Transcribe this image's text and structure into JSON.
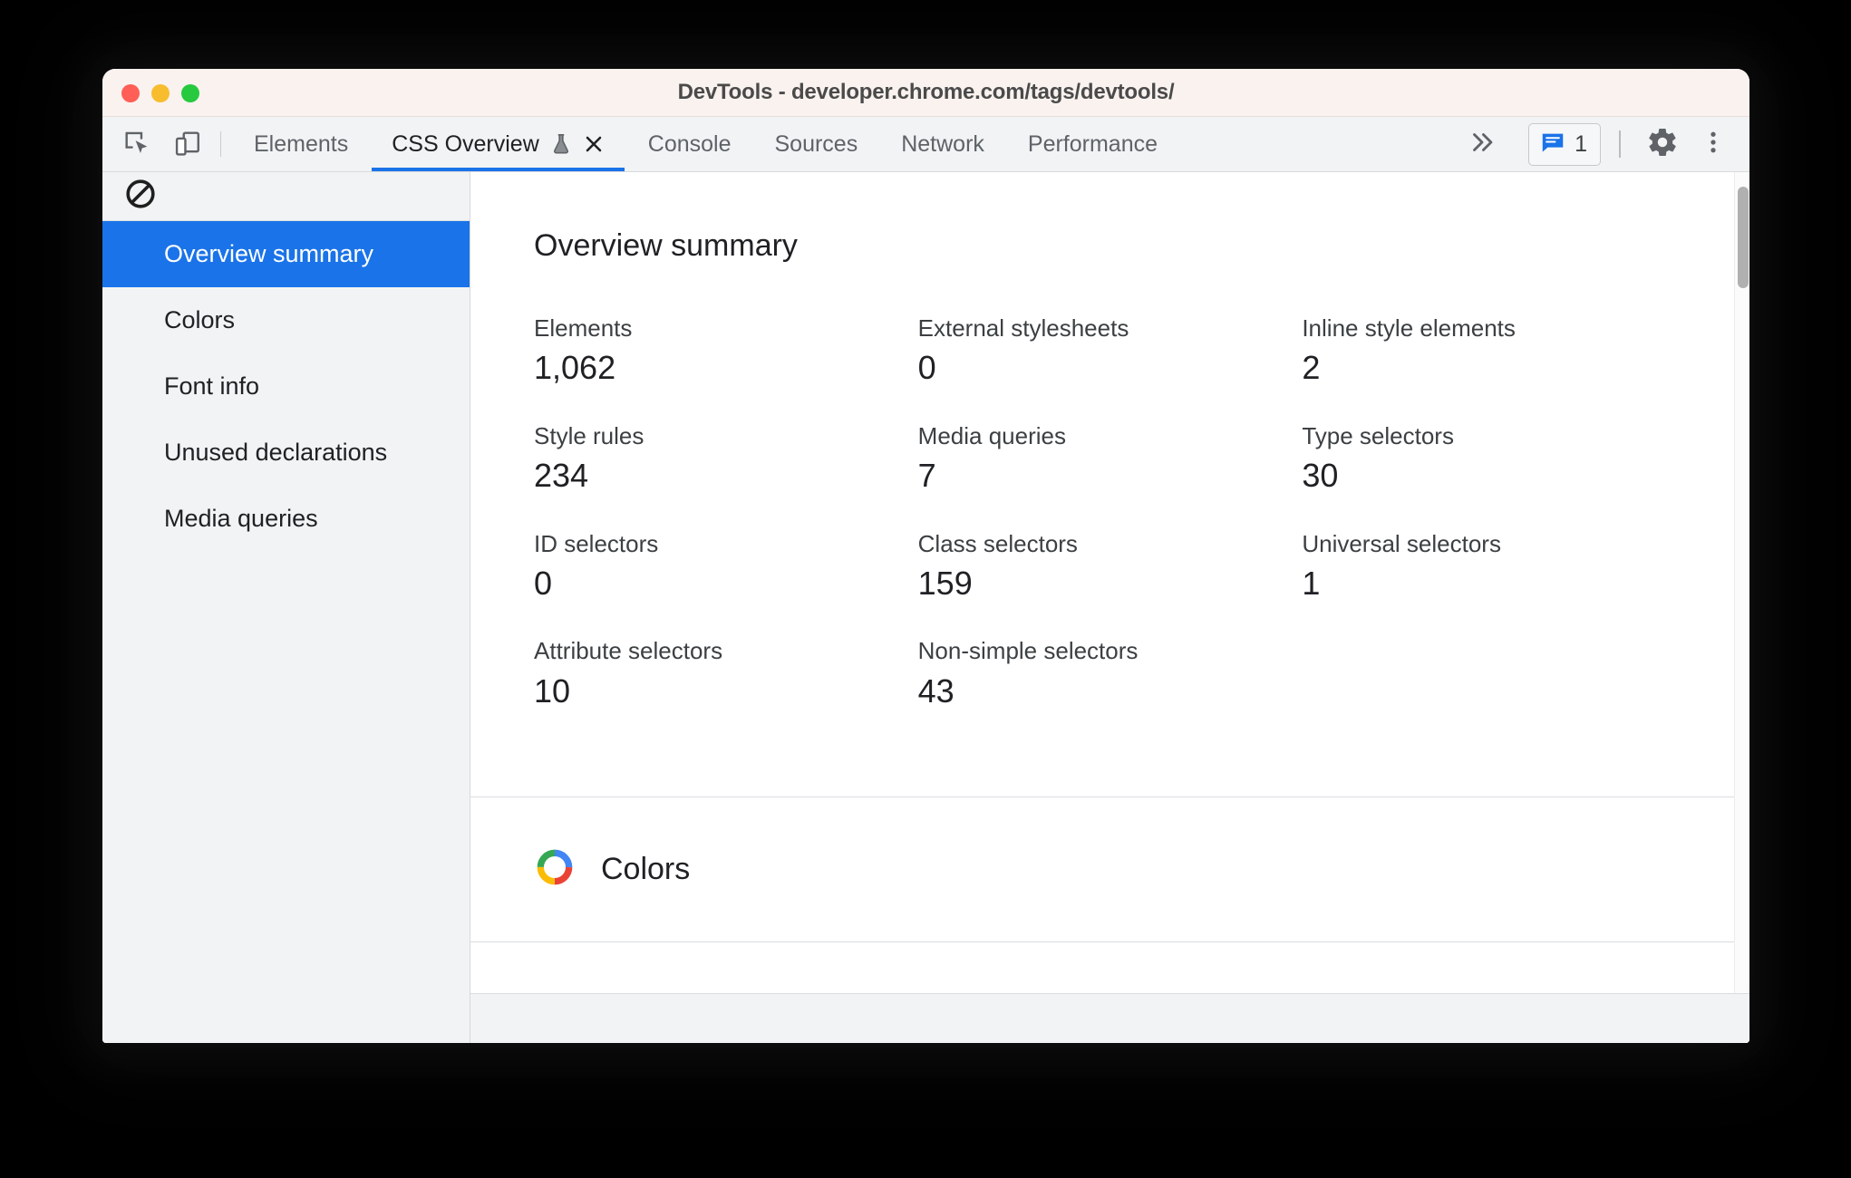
{
  "window": {
    "title": "DevTools - developer.chrome.com/tags/devtools/",
    "traffic_lights": {
      "close": "close-window",
      "minimize": "minimize-window",
      "maximize": "maximize-window"
    }
  },
  "toolbar": {
    "inspect_icon": "inspect-element-icon",
    "device_icon": "device-toolbar-icon",
    "overflow_label": "»",
    "issues": {
      "icon": "issues-message-icon",
      "count": "1"
    },
    "settings_icon": "gear-icon",
    "more_icon": "three-dot-menu-icon"
  },
  "tabs": [
    {
      "label": "Elements",
      "active": false,
      "closable": false,
      "experimental": false
    },
    {
      "label": "CSS Overview",
      "active": true,
      "closable": true,
      "experimental": true
    },
    {
      "label": "Console",
      "active": false,
      "closable": false,
      "experimental": false
    },
    {
      "label": "Sources",
      "active": false,
      "closable": false,
      "experimental": false
    },
    {
      "label": "Network",
      "active": false,
      "closable": false,
      "experimental": false
    },
    {
      "label": "Performance",
      "active": false,
      "closable": false,
      "experimental": false
    }
  ],
  "sidebar": {
    "clear_icon": "clear-block-icon",
    "items": [
      {
        "label": "Overview summary",
        "selected": true
      },
      {
        "label": "Colors",
        "selected": false
      },
      {
        "label": "Font info",
        "selected": false
      },
      {
        "label": "Unused declarations",
        "selected": false
      },
      {
        "label": "Media queries",
        "selected": false
      }
    ]
  },
  "main": {
    "summary": {
      "title": "Overview summary",
      "stats": [
        {
          "label": "Elements",
          "value": "1,062"
        },
        {
          "label": "External stylesheets",
          "value": "0"
        },
        {
          "label": "Inline style elements",
          "value": "2"
        },
        {
          "label": "Style rules",
          "value": "234"
        },
        {
          "label": "Media queries",
          "value": "7"
        },
        {
          "label": "Type selectors",
          "value": "30"
        },
        {
          "label": "ID selectors",
          "value": "0"
        },
        {
          "label": "Class selectors",
          "value": "159"
        },
        {
          "label": "Universal selectors",
          "value": "1"
        },
        {
          "label": "Attribute selectors",
          "value": "10"
        },
        {
          "label": "Non-simple selectors",
          "value": "43"
        },
        {
          "label": "",
          "value": ""
        }
      ]
    },
    "colors_section": {
      "title": "Colors",
      "icon": "color-wheel-icon"
    }
  },
  "colors": {
    "accent_blue": "#1a73e8",
    "titlebar_bg": "#faf2ef",
    "tabbar_bg": "#f1f3f4",
    "text_primary": "#202124",
    "text_secondary": "#5f6368",
    "traffic_red": "#ff5f56",
    "traffic_yellow": "#f8bd2e",
    "traffic_green": "#27c93f",
    "wheel_blue": "#4285f4",
    "wheel_red": "#ea4335",
    "wheel_yellow": "#fbbc05",
    "wheel_green": "#34a853"
  }
}
